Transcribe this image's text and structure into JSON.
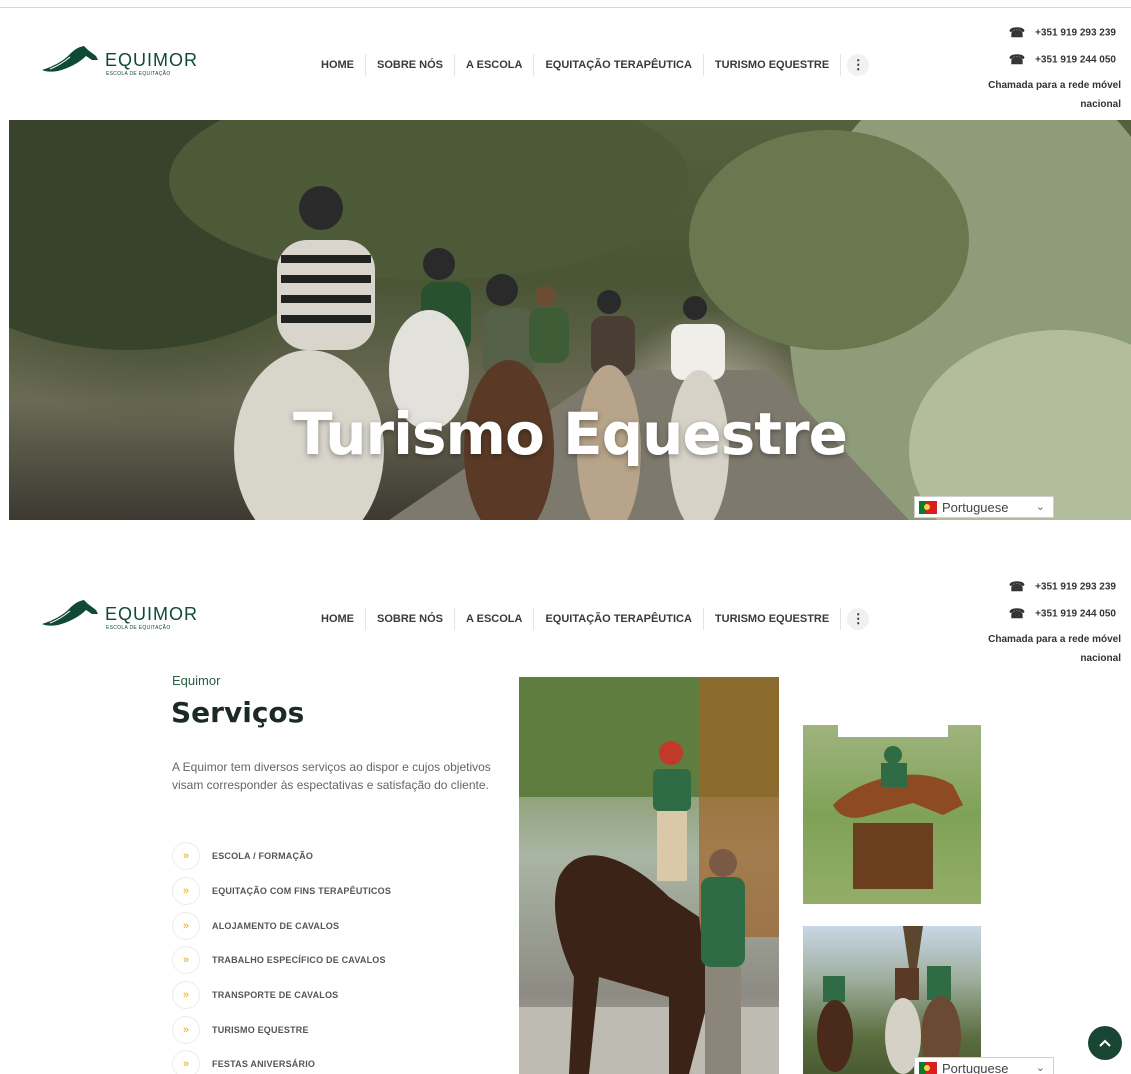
{
  "brand": {
    "name": "EQUIMOR",
    "tagline": "ESCOLA DE EQUITAÇÃO"
  },
  "nav": {
    "items": [
      "HOME",
      "SOBRE NÓS",
      "A ESCOLA",
      "EQUITAÇÃO TERAPÊUTICA",
      "TURISMO EQUESTRE"
    ],
    "more_icon": "⋮"
  },
  "contact": {
    "phones": [
      "+351 919 293 239",
      "+351 919 244 050"
    ],
    "note": "Chamada para a rede móvel nacional",
    "phone_icon": "phone-icon"
  },
  "hero": {
    "title": "Turismo Equestre"
  },
  "language": {
    "selected": "Portuguese"
  },
  "services": {
    "kicker": "Equimor",
    "title": "Serviços",
    "description": "A Equimor tem diversos serviços ao dispor e cujos objetivos visam corresponder às espectativas e satisfação do cliente.",
    "items": [
      "ESCOLA / FORMAÇÃO",
      "EQUITAÇÃO COM FINS TERAPÊUTICOS",
      "ALOJAMENTO DE CAVALOS",
      "TRABALHO ESPECÍFICO DE CAVALOS",
      "TRANSPORTE DE CAVALOS",
      "TURISMO EQUESTRE",
      "FESTAS ANIVERSÁRIO"
    ],
    "bullet": "»"
  },
  "colors": {
    "brand_green": "#0e4a35",
    "accent_gold": "#f0a800",
    "back_to_top": "#194634"
  }
}
